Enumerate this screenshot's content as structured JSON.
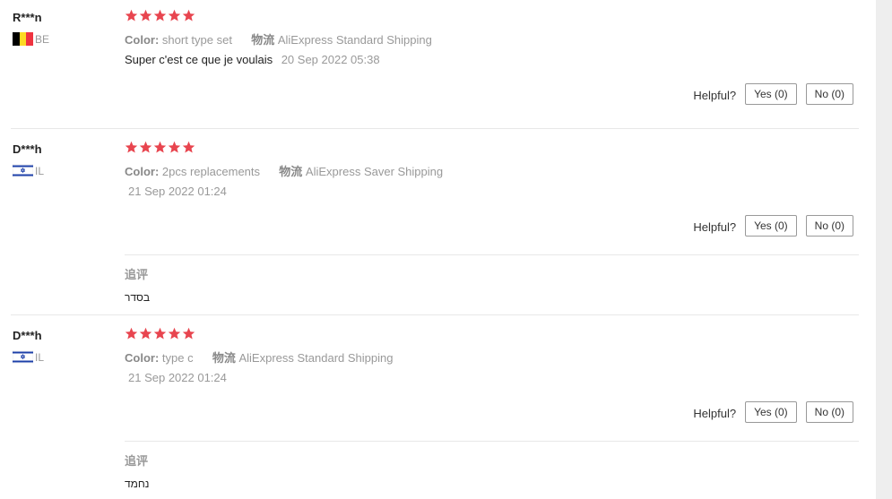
{
  "helpful_label": "Helpful?",
  "star_color": "#e8454f",
  "reviews": [
    {
      "user": "R***n",
      "country": "BE",
      "flag": "belgium-flag",
      "rating": 5,
      "color_label": "Color:",
      "color_value": "short type set",
      "shipping_label": "物流",
      "shipping_value": "AliExpress Standard Shipping",
      "text": "Super c'est ce que je voulais",
      "date": "20 Sep 2022 05:38",
      "yes": "Yes (0)",
      "no": "No (0)"
    },
    {
      "user": "D***h",
      "country": "IL",
      "flag": "israel-flag",
      "rating": 5,
      "color_label": "Color:",
      "color_value": "2pcs replacements",
      "shipping_label": "物流",
      "shipping_value": "AliExpress Saver Shipping",
      "date": "21 Sep 2022 01:24",
      "yes": "Yes (0)",
      "no": "No (0)",
      "followup_title": "追评",
      "followup_text": "בסדר"
    },
    {
      "user": "D***h",
      "country": "IL",
      "flag": "israel-flag",
      "rating": 5,
      "color_label": "Color:",
      "color_value": "type c",
      "shipping_label": "物流",
      "shipping_value": "AliExpress Standard Shipping",
      "date": "21 Sep 2022 01:24",
      "yes": "Yes (0)",
      "no": "No (0)",
      "followup_title": "追评",
      "followup_text": "נחמד"
    }
  ]
}
